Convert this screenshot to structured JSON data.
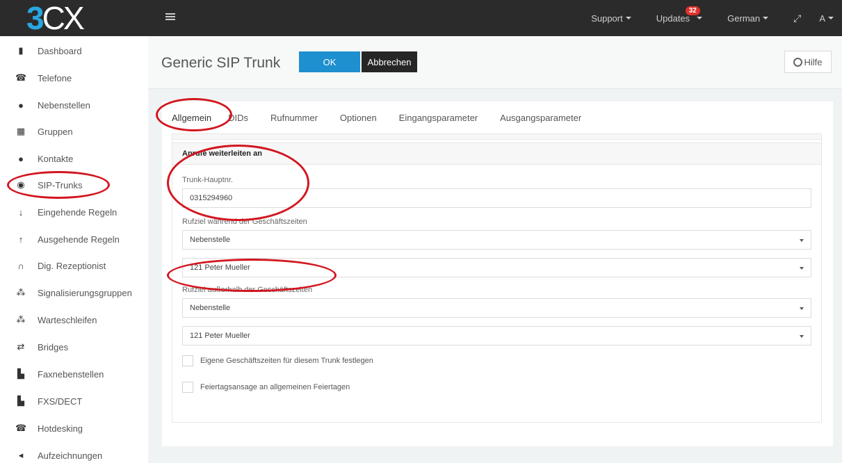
{
  "app": {
    "logo_three": "3",
    "logo_cx": "CX",
    "logo_dot": "."
  },
  "topbar": {
    "support": "Support",
    "updates": "Updates",
    "updates_badge": "32",
    "language": "German",
    "user": "A"
  },
  "sidebar": {
    "items": [
      {
        "label": "Dashboard",
        "icon": "bar-chart-icon"
      },
      {
        "label": "Telefone",
        "icon": "telephone-icon"
      },
      {
        "label": "Nebenstellen",
        "icon": "user-icon"
      },
      {
        "label": "Gruppen",
        "icon": "grid-icon"
      },
      {
        "label": "Kontakte",
        "icon": "contact-icon"
      },
      {
        "label": "SIP-Trunks",
        "icon": "globe-icon"
      },
      {
        "label": "Eingehende Regeln",
        "icon": "arrow-down-icon"
      },
      {
        "label": "Ausgehende Regeln",
        "icon": "arrow-up-icon"
      },
      {
        "label": "Dig. Rezeptionist",
        "icon": "headset-icon"
      },
      {
        "label": "Signalisierungsgruppen",
        "icon": "users-icon"
      },
      {
        "label": "Warteschleifen",
        "icon": "users-icon"
      },
      {
        "label": "Bridges",
        "icon": "exchange-icon"
      },
      {
        "label": "Faxnebenstellen",
        "icon": "fax-icon"
      },
      {
        "label": "FXS/DECT",
        "icon": "fax-icon"
      },
      {
        "label": "Hotdesking",
        "icon": "telephone-icon"
      },
      {
        "label": "Aufzeichnungen",
        "icon": "speaker-icon"
      }
    ]
  },
  "header": {
    "title": "Generic SIP Trunk",
    "ok_label": "OK",
    "cancel_label": "Abbrechen",
    "help_label": "Hilfe"
  },
  "tabs": [
    {
      "label": "Allgemein",
      "active": true
    },
    {
      "label": "DIDs"
    },
    {
      "label": "Rufnummer"
    },
    {
      "label": "Optionen"
    },
    {
      "label": "Eingangsparameter"
    },
    {
      "label": "Ausgangsparameter"
    }
  ],
  "form": {
    "section_title": "Anrufe weiterleiten an",
    "trunk_main_label": "Trunk-Hauptnr.",
    "trunk_main_value": "0315294960",
    "business_hours_label": "Rufziel während der Geschäftszeiten",
    "business_hours_type": "Nebenstelle",
    "business_hours_target": "121 Peter Mueller",
    "after_hours_label": "Rufziel außerhalb der Geschäftszeiten",
    "after_hours_type": "Nebenstelle",
    "after_hours_target": "121 Peter Mueller",
    "own_hours_label": "Eigene Geschäftszeiten für diesem Trunk festlegen",
    "holiday_label": "Feiertagsansage an allgemeinen Feiertagen"
  },
  "colors": {
    "accent": "#1e8fcf",
    "logo_blue": "#28a7e1",
    "topbar": "#2b2b2b",
    "annotation": "#d2161f"
  }
}
